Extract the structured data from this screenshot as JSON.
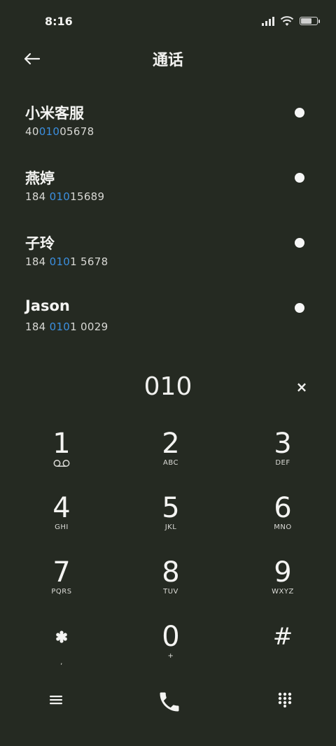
{
  "status_bar": {
    "time": "8:16",
    "signal_icon": "signal-icon",
    "wifi_icon": "wifi-icon",
    "battery_icon": "battery-icon",
    "battery_level": 0.7
  },
  "header": {
    "back_icon": "back-arrow-icon",
    "title": "通话"
  },
  "contacts": [
    {
      "name": "小米客服",
      "number_parts": [
        "40",
        "010",
        "05678"
      ]
    },
    {
      "name": "燕婷",
      "number_parts": [
        "184 ",
        "010",
        "15689"
      ]
    },
    {
      "name": "子玲",
      "number_parts": [
        "184 ",
        "010",
        "1 5678"
      ]
    },
    {
      "name": "Jason",
      "number_parts": [
        "184 ",
        "010",
        "1 0029"
      ]
    }
  ],
  "dial": {
    "value": "010",
    "clear_label": "×"
  },
  "keypad": [
    {
      "digit": "1",
      "sub": "voicemail-icon"
    },
    {
      "digit": "2",
      "sub": "ABC"
    },
    {
      "digit": "3",
      "sub": "DEF"
    },
    {
      "digit": "4",
      "sub": "GHI"
    },
    {
      "digit": "5",
      "sub": "JKL"
    },
    {
      "digit": "6",
      "sub": "MNO"
    },
    {
      "digit": "7",
      "sub": "PQRS"
    },
    {
      "digit": "8",
      "sub": "TUV"
    },
    {
      "digit": "9",
      "sub": "WXYZ"
    },
    {
      "digit": "*",
      "sub": ","
    },
    {
      "digit": "0",
      "sub": "+"
    },
    {
      "digit": "#",
      "sub": ""
    }
  ],
  "bottom_bar": {
    "menu_icon": "menu-icon",
    "call_icon": "phone-call-icon",
    "keypad_icon": "dialpad-icon"
  },
  "colors": {
    "background": "#252a22",
    "text": "#f2f2f0",
    "highlight": "#3b8fe0"
  }
}
